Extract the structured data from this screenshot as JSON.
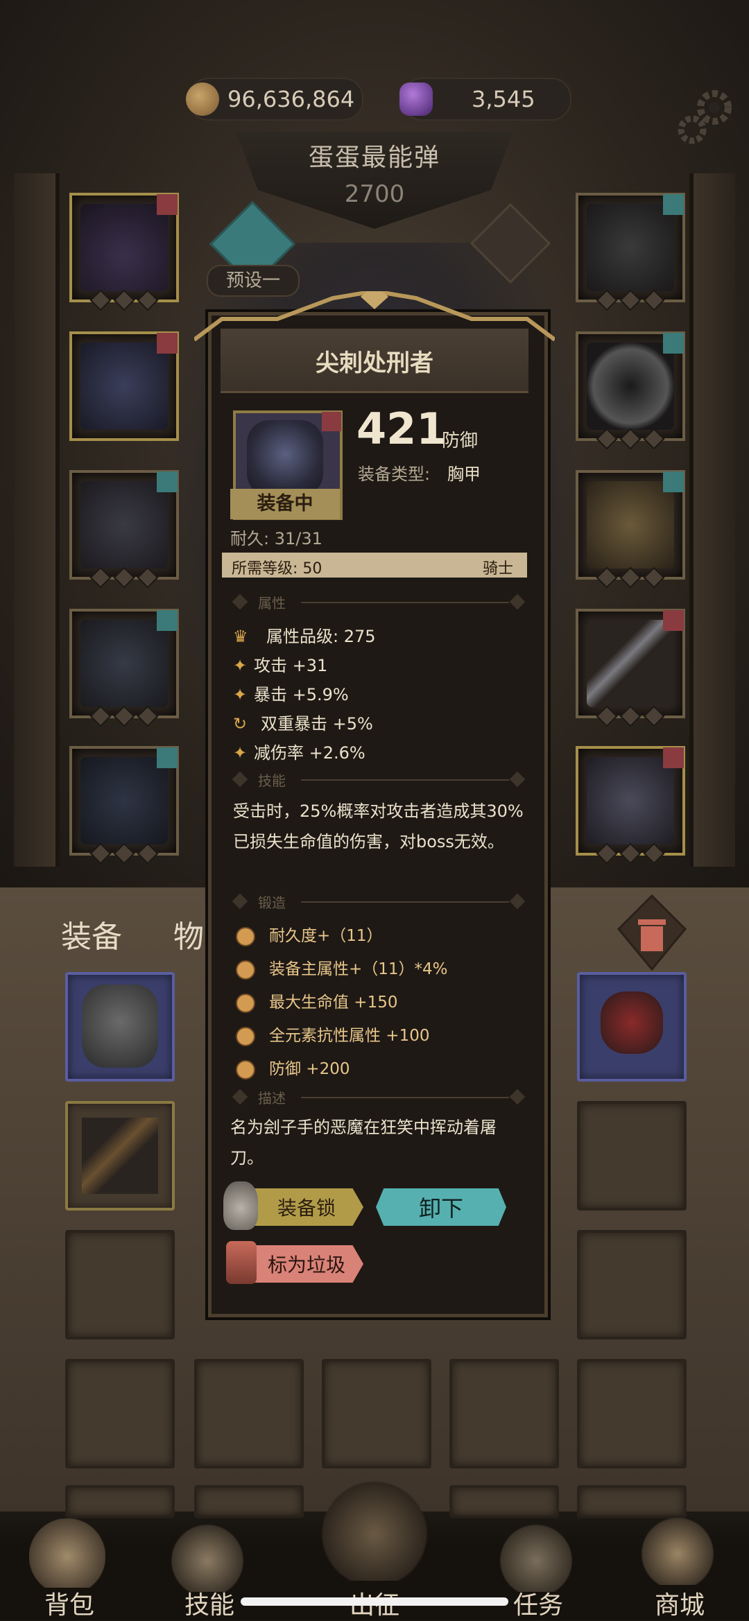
{
  "currency": {
    "gold": "96,636,864",
    "crystal": "3,545"
  },
  "header": {
    "title": "蛋蛋最能弹",
    "power": "2700",
    "preset_label": "预设一"
  },
  "tabs": {
    "equipment": "装备",
    "items": "物品"
  },
  "popup": {
    "name": "尖刺处刑者",
    "equipped_label": "装备中",
    "value": "421",
    "value_unit": "防御",
    "type_label": "装备类型:",
    "type_value": "胸甲",
    "durability": "耐久: 31/31",
    "level_req": "所需等级: 50",
    "level_role": "骑士",
    "sections": {
      "attributes": "属性",
      "skill": "技能",
      "forge": "锻造",
      "description": "描述"
    },
    "attributes": [
      "属性品级: 275",
      "攻击 +31",
      "暴击 +5.9%",
      "双重暴击 +5%",
      "减伤率 +2.6%"
    ],
    "skill_text": "受击时，25%概率对攻击者造成其30%已损失生命值的伤害，对boss无效。",
    "forge": [
      "耐久度+（11）",
      "装备主属性+（11）*4%",
      "最大生命值 +150",
      "全元素抗性属性 +100",
      "防御 +200"
    ],
    "description": "名为刽子手的恶魔在狂笑中挥动着屠刀。",
    "buttons": {
      "lock": "装备锁",
      "unequip": "卸下",
      "trash": "标为垃圾"
    }
  },
  "nav": [
    "背包",
    "技能",
    "出征",
    "任务",
    "商城"
  ],
  "colors": {
    "teal_button": "#56b0b0",
    "gold_button": "#b19b48",
    "trash_button": "#d98277",
    "forge_text": "#e9c68a"
  }
}
